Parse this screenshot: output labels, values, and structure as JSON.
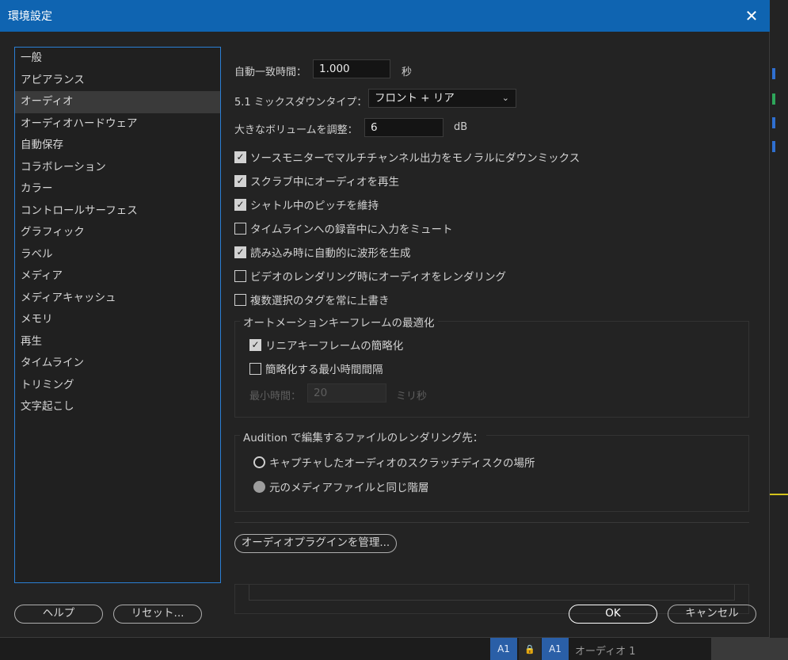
{
  "title": "環境設定",
  "sidebar": {
    "items": [
      "一般",
      "アピアランス",
      "オーディオ",
      "オーディオハードウェア",
      "自動保存",
      "コラボレーション",
      "カラー",
      "コントロールサーフェス",
      "グラフィック",
      "ラベル",
      "メディア",
      "メディアキャッシュ",
      "メモリ",
      "再生",
      "タイムライン",
      "トリミング",
      "文字起こし"
    ],
    "selected": "オーディオ"
  },
  "audio": {
    "auto_match_label": "自動一致時間：",
    "auto_match_value": "1.000",
    "auto_match_unit": "秒",
    "downmix_label": "5.1 ミックスダウンタイプ：",
    "downmix_value": "フロント + リア",
    "volume_label": "大きなボリュームを調整：",
    "volume_value": "6",
    "volume_unit": "dB",
    "checkboxes": [
      {
        "label": "ソースモニターでマルチチャンネル出力をモノラルにダウンミックス",
        "checked": true
      },
      {
        "label": "スクラブ中にオーディオを再生",
        "checked": true
      },
      {
        "label": "シャトル中のピッチを維持",
        "checked": true
      },
      {
        "label": "タイムラインへの録音中に入力をミュート",
        "checked": false
      },
      {
        "label": "読み込み時に自動的に波形を生成",
        "checked": true
      },
      {
        "label": "ビデオのレンダリング時にオーディオをレンダリング",
        "checked": false
      },
      {
        "label": "複数選択のタグを常に上書き",
        "checked": false
      }
    ],
    "automation": {
      "title": "オートメーションキーフレームの最適化",
      "linear_label": "リニアキーフレームの簡略化",
      "linear_checked": true,
      "min_interval_label": "簡略化する最小時間間隔",
      "min_interval_checked": false,
      "min_time_label": "最小時間：",
      "min_time_value": "20",
      "min_time_unit": "ミリ秒"
    },
    "audition": {
      "title": "Audition で編集するファイルのレンダリング先：",
      "option1": "キャプチャしたオーディオのスクラッチディスクの場所",
      "option2": "元のメディアファイルと同じ階層"
    },
    "manage_plugins": "オーディオプラグインを管理..."
  },
  "footer": {
    "help": "ヘルプ",
    "reset": "リセット...",
    "ok": "OK",
    "cancel": "キャンセル"
  },
  "background": {
    "chip_a": "A1",
    "chip_b": "A1",
    "track_name": "オーディオ 1"
  },
  "colors": {
    "titlebar": "#0f64b1",
    "accent_border": "#2b7fd4"
  }
}
